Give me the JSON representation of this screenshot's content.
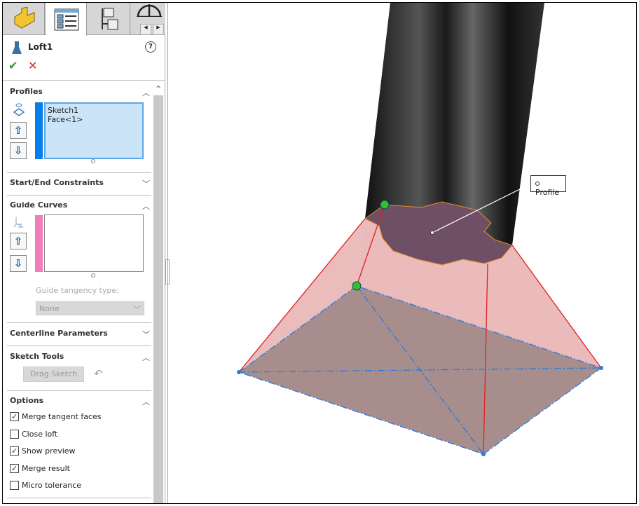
{
  "feature": {
    "name": "Loft1",
    "ok": "✔",
    "cancel": "✕",
    "help": "?"
  },
  "sections": {
    "profiles": {
      "title": "Profiles",
      "items": [
        "Sketch1",
        "Face<1>"
      ]
    },
    "start_end": {
      "title": "Start/End Constraints"
    },
    "guide_curves": {
      "title": "Guide Curves",
      "tangency_label": "Guide tangency type:",
      "tangency_value": "None"
    },
    "centerline": {
      "title": "Centerline Parameters"
    },
    "sketch_tools": {
      "title": "Sketch Tools",
      "drag_sketch": "Drag Sketch"
    },
    "options": {
      "title": "Options",
      "checkboxes": [
        {
          "label": "Merge tangent faces",
          "checked": true
        },
        {
          "label": "Close loft",
          "checked": false
        },
        {
          "label": "Show preview",
          "checked": true
        },
        {
          "label": "Merge result",
          "checked": true
        },
        {
          "label": "Micro tolerance",
          "checked": false
        }
      ]
    }
  },
  "viewport": {
    "callout": "Profile"
  },
  "colors": {
    "profile_bar": "#0a7ee8",
    "guide_bar": "#f07cb8",
    "selection_bg": "#cce4f7"
  }
}
